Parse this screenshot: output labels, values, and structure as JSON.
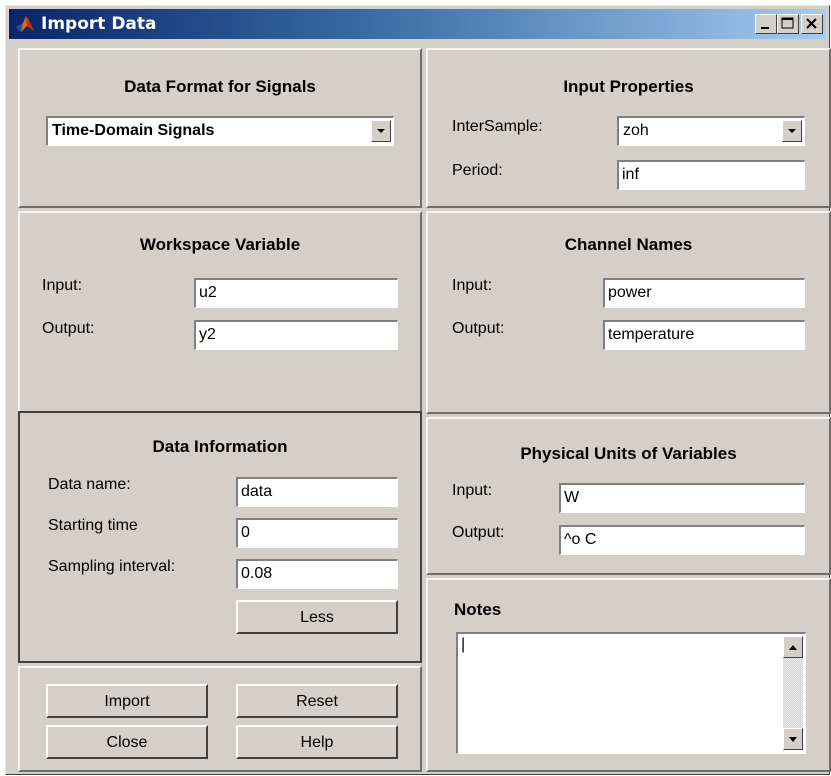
{
  "window": {
    "title": "Import Data"
  },
  "data_format": {
    "title": "Data Format for Signals",
    "selected": "Time-Domain Signals"
  },
  "input_properties": {
    "title": "Input Properties",
    "intersample_label": "InterSample:",
    "intersample_value": "zoh",
    "period_label": "Period:",
    "period_value": "inf"
  },
  "workspace_variable": {
    "title": "Workspace Variable",
    "input_label": "Input:",
    "input_value": "u2",
    "output_label": "Output:",
    "output_value": "y2"
  },
  "channel_names": {
    "title": "Channel Names",
    "input_label": "Input:",
    "input_value": "power",
    "output_label": "Output:",
    "output_value": "temperature"
  },
  "data_information": {
    "title": "Data Information",
    "name_label": "Data name:",
    "name_value": "data",
    "start_label": "Starting time",
    "start_value": "0",
    "interval_label": "Sampling interval:",
    "interval_value": "0.08",
    "less_button": "Less"
  },
  "physical_units": {
    "title": "Physical Units of Variables",
    "input_label": "Input:",
    "input_value": "W",
    "output_label": "Output:",
    "output_value": "^o C"
  },
  "notes": {
    "title": "Notes",
    "value": "|"
  },
  "actions": {
    "import": "Import",
    "reset": "Reset",
    "close": "Close",
    "help": "Help"
  },
  "colors": {
    "titlebar_start": "#0a246a",
    "titlebar_end": "#a6caf0",
    "face": "#d4d0c8"
  }
}
